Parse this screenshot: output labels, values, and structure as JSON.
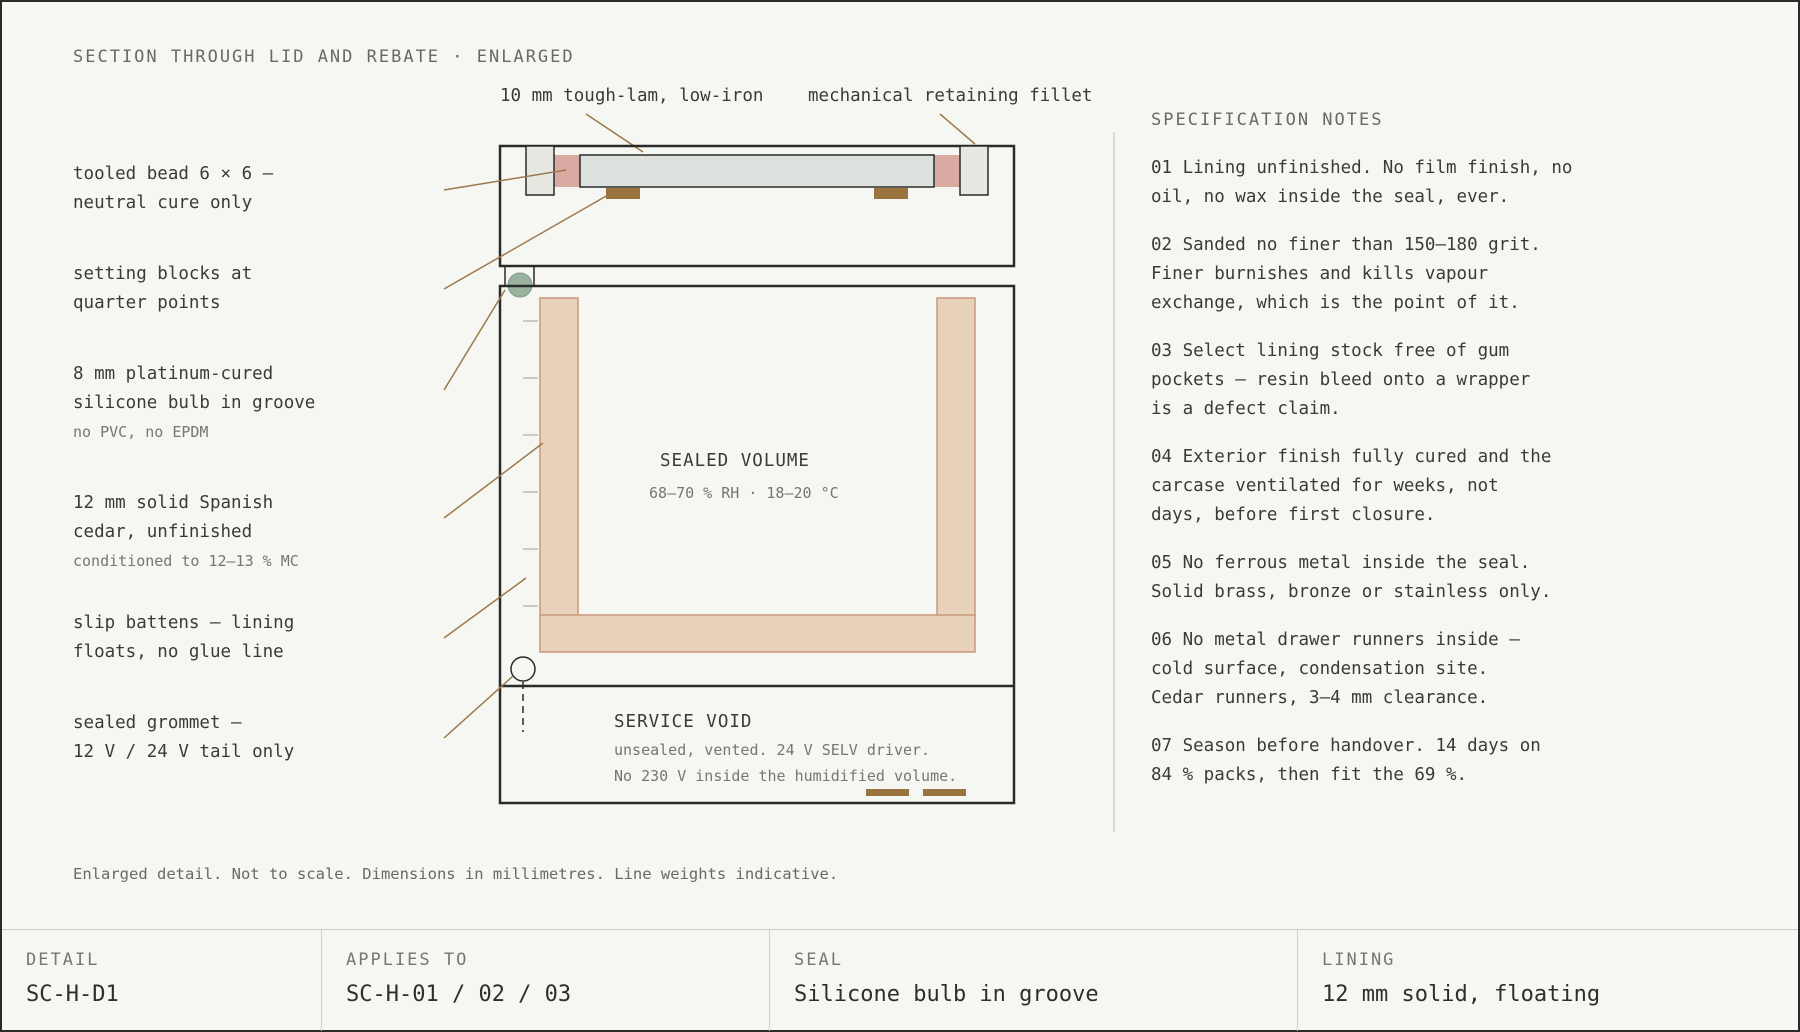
{
  "title": "SECTION THROUGH LID AND REBATE · ENLARGED",
  "top_labels": {
    "glass": "10 mm tough-lam, low-iron",
    "fillet": "mechanical retaining fillet"
  },
  "callouts": [
    {
      "main": "tooled bead 6 × 6 —\nneutral cure only",
      "sub": ""
    },
    {
      "main": "setting blocks at\nquarter points",
      "sub": ""
    },
    {
      "main": "8 mm platinum-cured\nsilicone bulb in groove",
      "sub": "no PVC, no EPDM"
    },
    {
      "main": "12 mm solid Spanish\ncedar, unfinished",
      "sub": "conditioned to 12–13 % MC"
    },
    {
      "main": "slip battens — lining\nfloats, no glue line",
      "sub": ""
    },
    {
      "main": "sealed grommet —\n12 V / 24 V tail only",
      "sub": ""
    }
  ],
  "sealed_volume": {
    "label": "SEALED VOLUME",
    "conditions": "68–70 % RH · 18–20 °C"
  },
  "service_void": {
    "label": "SERVICE VOID",
    "line1": "unsealed, vented. 24 V SELV driver.",
    "line2": "No 230 V inside the humidified volume."
  },
  "notes": {
    "heading": "SPECIFICATION NOTES",
    "items": [
      "01 Lining unfinished. No film finish, no\noil, no wax inside the seal, ever.",
      "02 Sanded no finer than 150–180 grit.\nFiner burnishes and kills vapour\nexchange, which is the point of it.",
      "03 Select lining stock free of gum\npockets — resin bleed onto a wrapper\nis a defect claim.",
      "04 Exterior finish fully cured and the\ncarcase ventilated for weeks, not\ndays, before first closure.",
      "05 No ferrous metal inside the seal.\nSolid brass, bronze or stainless only.",
      "06 No metal drawer runners inside —\ncold surface, condensation site.\nCedar runners, 3–4 mm clearance.",
      "07 Season before handover. 14 days on\n84 % packs, then fit the 69 %."
    ]
  },
  "disclaimer": "Enlarged detail. Not to scale. Dimensions in millimetres. Line weights indicative.",
  "footer": [
    {
      "label": "DETAIL",
      "value": "SC-H-D1"
    },
    {
      "label": "APPLIES TO",
      "value": "SC-H-01 / 02 / 03"
    },
    {
      "label": "SEAL",
      "value": "Silicone bulb in groove"
    },
    {
      "label": "LINING",
      "value": "12 mm solid, floating"
    }
  ],
  "colors": {
    "ink": "#2a2a2a",
    "leader": "#9a7a4a",
    "cedar_fill": "#e8d2bc",
    "cedar_stroke": "#c9987a",
    "bead": "#d9aaa2",
    "glass": "#dde2de",
    "setting_block": "#9a743e",
    "bulb": "#9ab39e",
    "fillet": "#e8e8e2"
  }
}
